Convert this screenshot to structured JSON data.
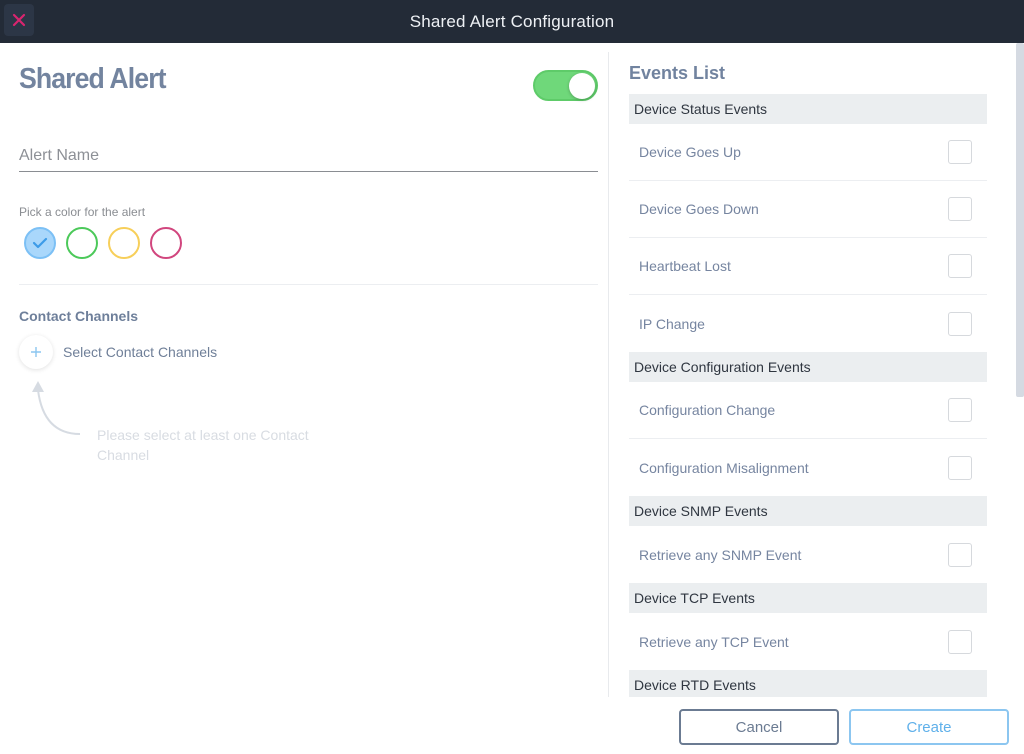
{
  "window": {
    "title": "Shared Alert Configuration",
    "close_icon": "close-x-icon"
  },
  "form": {
    "heading": "Shared Alert",
    "enabled": true,
    "alert_name": {
      "value": "",
      "placeholder": "Alert Name"
    },
    "color_label": "Pick a color for the alert",
    "colors": [
      {
        "name": "blue",
        "hex": "#a9d7fb",
        "border": "#7cc0f5",
        "selected": true
      },
      {
        "name": "green",
        "hex": "#ffffff",
        "border": "#4cc95a",
        "selected": false
      },
      {
        "name": "yellow",
        "hex": "#ffffff",
        "border": "#f7cf5a",
        "selected": false
      },
      {
        "name": "magenta",
        "hex": "#ffffff",
        "border": "#d1467e",
        "selected": false
      }
    ],
    "contact_channels": {
      "title": "Contact Channels",
      "add_label": "Select Contact Channels",
      "hint": "Please select at least one Contact Channel"
    }
  },
  "events": {
    "title": "Events List",
    "groups": [
      {
        "name": "Device Status Events",
        "items": [
          {
            "label": "Device Goes Up",
            "checked": false
          },
          {
            "label": "Device Goes Down",
            "checked": false
          },
          {
            "label": "Heartbeat Lost",
            "checked": false
          },
          {
            "label": "IP Change",
            "checked": false
          }
        ]
      },
      {
        "name": "Device Configuration Events",
        "items": [
          {
            "label": "Configuration Change",
            "checked": false
          },
          {
            "label": "Configuration Misalignment",
            "checked": false
          }
        ]
      },
      {
        "name": "Device SNMP Events",
        "items": [
          {
            "label": "Retrieve any SNMP Event",
            "checked": false
          }
        ]
      },
      {
        "name": "Device TCP Events",
        "items": [
          {
            "label": "Retrieve any TCP Event",
            "checked": false
          }
        ]
      },
      {
        "name": "Device RTD Events",
        "items": []
      }
    ]
  },
  "footer": {
    "cancel_label": "Cancel",
    "create_label": "Create"
  },
  "theme": {
    "header_bg": "#232b37",
    "close_color": "#d9256f",
    "toggle_on": "#6fd87a",
    "accent": "#5fb0ea"
  }
}
